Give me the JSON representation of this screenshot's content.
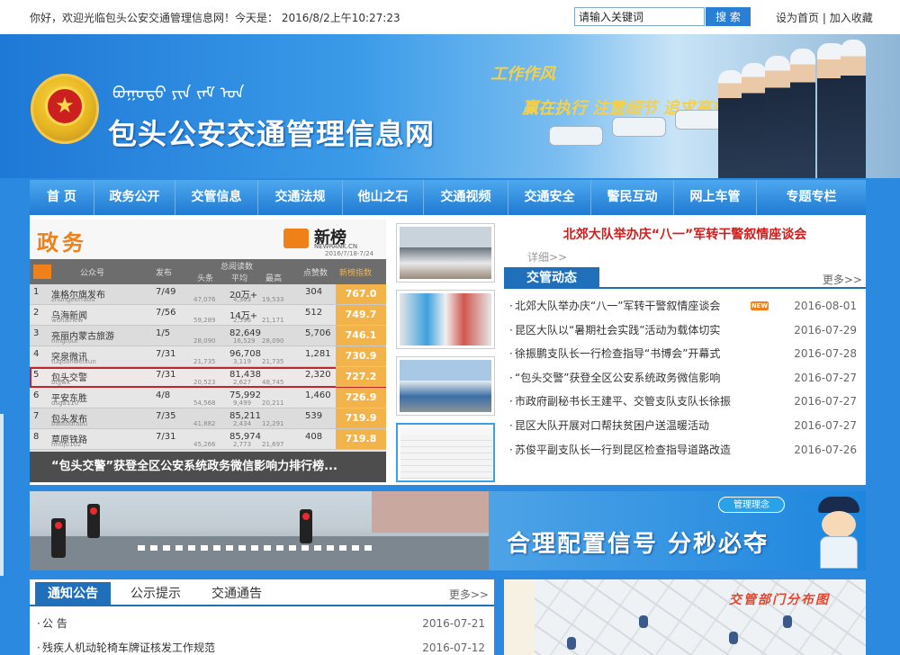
{
  "topbar": {
    "welcome": "你好，欢迎光临包头公安交通管理信息网！今天是： 2016/8/2上午10:27:23",
    "search_placeholder": "请输入关键词",
    "search_button": "搜 索",
    "set_home": "设为首页",
    "separator": " | ",
    "favorite": "加入收藏"
  },
  "banner": {
    "site_title": "包头公安交通管理信息网",
    "mongolian_script": "ᠪᠤᠭᠤᠲᠤ ᠶᠢᠨ ᠵᠠᠮ ᠤᠨ",
    "slogan_line1": "工作作风",
    "slogan_line2": "赢在执行 注重细节 追求高效"
  },
  "nav": {
    "items": [
      {
        "label": "首 页"
      },
      {
        "label": "政务公开"
      },
      {
        "label": "交管信息"
      },
      {
        "label": "交通法规"
      },
      {
        "label": "他山之石"
      },
      {
        "label": "交通视频"
      },
      {
        "label": "交通安全"
      },
      {
        "label": "警民互动"
      },
      {
        "label": "网上车管"
      },
      {
        "label": "专题专栏"
      }
    ]
  },
  "slideshow": {
    "image_heading": "政务",
    "brand_name": "新榜",
    "brand_domain": "NEWRANK.CN",
    "brand_date": "2016/7/18-7/24",
    "table_headers": {
      "account": "公众号",
      "published": "发布",
      "total_reads": "总阅读数",
      "headline": "头条",
      "average": "平均",
      "max": "最高",
      "likes": "点赞数",
      "index": "新榜指数"
    },
    "rows": [
      {
        "rank": "1",
        "name": "准格尔旗发布",
        "sub": "zhungeerfabu",
        "pub": "7/49",
        "total": "20万+",
        "head": "47,076",
        "avg": "4,363",
        "max": "19,533",
        "likes": "304",
        "index": "767.0"
      },
      {
        "rank": "2",
        "name": "乌海新闻",
        "sub": "wuhainew",
        "pub": "7/56",
        "total": "14万+",
        "head": "59,289",
        "avg": "2,596",
        "max": "21,171",
        "likes": "512",
        "index": "749.7"
      },
      {
        "rank": "3",
        "name": "亮丽内蒙古旅游",
        "sub": "nmgtour",
        "pub": "1/5",
        "total": "82,649",
        "head": "28,090",
        "avg": "16,529",
        "max": "28,090",
        "likes": "5,706",
        "index": "746.1"
      },
      {
        "rank": "4",
        "name": "突泉微讯",
        "sub": "tuquanweixun",
        "pub": "7/31",
        "total": "96,708",
        "head": "21,735",
        "avg": "3,119",
        "max": "21,735",
        "likes": "1,281",
        "index": "730.9"
      },
      {
        "rank": "5",
        "name": "包头交警",
        "sub": "btjjwx",
        "pub": "7/31",
        "total": "81,438",
        "head": "20,523",
        "avg": "2,627",
        "max": "48,745",
        "likes": "2,320",
        "index": "727.2"
      },
      {
        "rank": "6",
        "name": "平安东胜",
        "sub": "dsga110",
        "pub": "4/8",
        "total": "75,992",
        "head": "54,568",
        "avg": "9,499",
        "max": "20,211",
        "likes": "1,460",
        "index": "726.9"
      },
      {
        "rank": "7",
        "name": "包头发布",
        "sub": "baotoufabu",
        "pub": "7/35",
        "total": "85,211",
        "head": "41,882",
        "avg": "2,434",
        "max": "12,291",
        "likes": "539",
        "index": "719.9"
      },
      {
        "rank": "8",
        "name": "草原铁路",
        "sub": "hhtlj0102",
        "pub": "7/31",
        "total": "85,974",
        "head": "45,266",
        "avg": "2,773",
        "max": "21,697",
        "likes": "408",
        "index": "719.8"
      }
    ],
    "caption": "“包头交警”获登全区公安系统政务微信影响力排行榜..."
  },
  "news": {
    "headline": "北郊大队举办庆“八一”军转干警叙情座谈会",
    "detail_link": "详细>>",
    "tab_label": "交管动态",
    "more_label": "更多>>",
    "new_badge": "NEW",
    "items": [
      {
        "title": "北郊大队举办庆“八一”军转干警叙情座谈会",
        "date": "2016-08-01"
      },
      {
        "title": "昆区大队以“暑期社会实践”活动为载体切实",
        "date": "2016-07-29"
      },
      {
        "title": "徐振鹏支队长一行检查指导“书博会”开幕式",
        "date": "2016-07-28"
      },
      {
        "title": "“包头交警”获登全区公安系统政务微信影响",
        "date": "2016-07-27"
      },
      {
        "title": "市政府副秘书长王建平、交管支队支队长徐振",
        "date": "2016-07-27"
      },
      {
        "title": "昆区大队开展对口帮扶贫困户送温暖活动",
        "date": "2016-07-27"
      },
      {
        "title": "苏俊平副支队长一行到昆区检查指导道路改造",
        "date": "2016-07-26"
      }
    ]
  },
  "ad": {
    "tag": "管理理念",
    "text": "合理配置信号  分秒必夺"
  },
  "notices": {
    "tabs": [
      {
        "label": "通知公告"
      },
      {
        "label": "公示提示"
      },
      {
        "label": "交通通告"
      }
    ],
    "more_label": "更多>>",
    "items": [
      {
        "title": "公  告",
        "date": "2016-07-21"
      },
      {
        "title": "残疾人机动轮椅车牌证核发工作规范",
        "date": "2016-07-12"
      }
    ]
  },
  "map": {
    "title": "交管部门分布图"
  },
  "colors": {
    "nav_blue": "#1f7ad2",
    "tab_blue": "#1f6fba",
    "headline_red": "#d41c1c",
    "index_orange": "#f2b44a"
  }
}
